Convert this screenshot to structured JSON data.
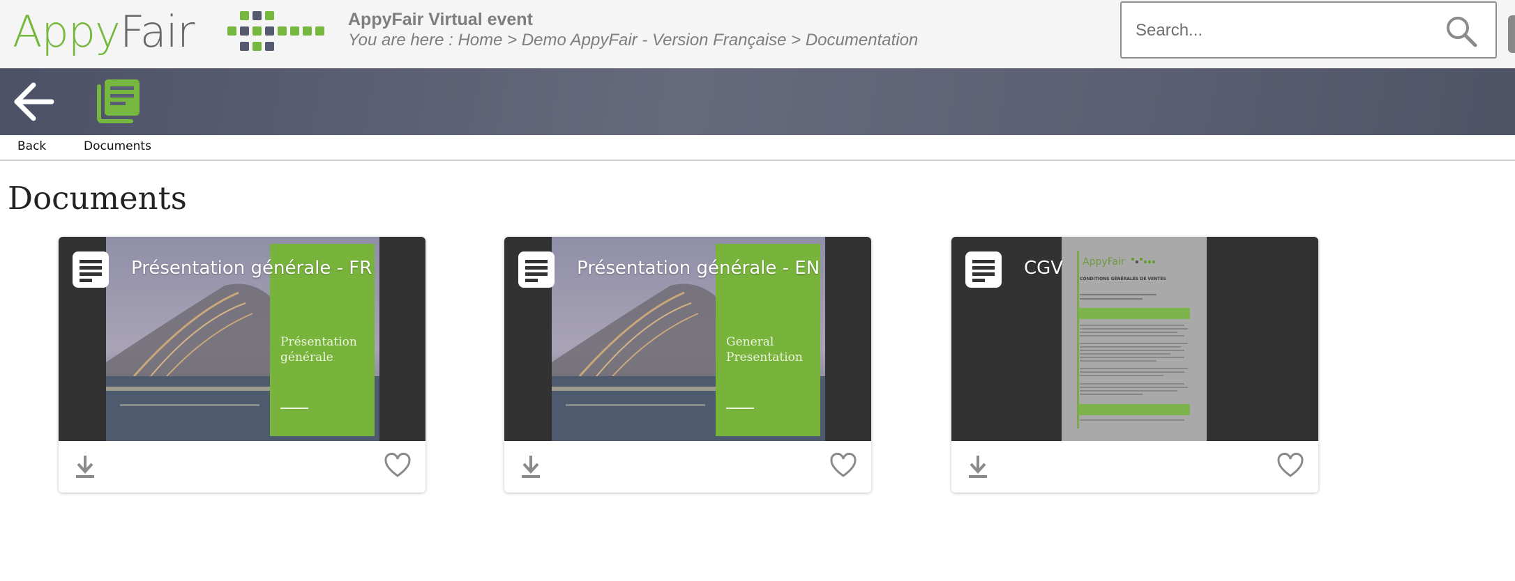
{
  "header": {
    "logo": {
      "part1": "Appy",
      "part2": "Fair",
      "color_green": "#76b83f",
      "color_gray": "#666666"
    },
    "event_title": "AppyFair Virtual event",
    "breadcrumb": "You are here : Home > Demo AppyFair - Version Française > Documentation",
    "search": {
      "placeholder": "Search...",
      "value": "",
      "icon": "search-icon"
    }
  },
  "toolbar": {
    "background": "#5c5f73",
    "items": [
      {
        "label": "Back",
        "icon": "arrow-left-icon"
      },
      {
        "label": "Documents",
        "icon": "documents-icon",
        "icon_color": "#76b83f"
      }
    ]
  },
  "main": {
    "title": "Documents",
    "cards": [
      {
        "title": "Présentation générale - FR",
        "cover_text": "Présentation générale",
        "icon": "document-icon",
        "actions": [
          "download-icon",
          "heart-icon"
        ]
      },
      {
        "title": "Présentation générale - EN",
        "cover_text": "General Presentation",
        "icon": "document-icon",
        "actions": [
          "download-icon",
          "heart-icon"
        ]
      },
      {
        "title": "CGV",
        "cover_text": "CONDITIONS GÉNÉRALES DE VENTES",
        "icon": "document-icon",
        "actions": [
          "download-icon",
          "heart-icon"
        ]
      }
    ]
  },
  "colors": {
    "accent_green": "#76b83f",
    "text_gray": "#7d7d7d",
    "dark_thumb": "#323232"
  }
}
